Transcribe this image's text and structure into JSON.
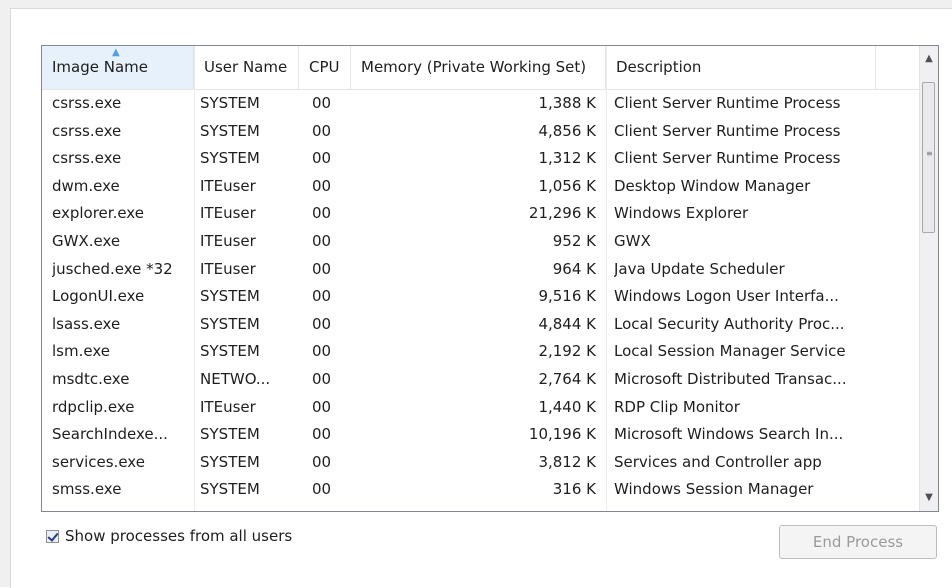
{
  "columns": {
    "image_name": "Image Name",
    "user_name": "User Name",
    "cpu": "CPU",
    "memory": "Memory (Private Working Set)",
    "description": "Description"
  },
  "processes": [
    {
      "name": "csrss.exe",
      "user": "SYSTEM",
      "cpu": "00",
      "mem": "1,388 K",
      "desc": "Client Server Runtime Process"
    },
    {
      "name": "csrss.exe",
      "user": "SYSTEM",
      "cpu": "00",
      "mem": "4,856 K",
      "desc": "Client Server Runtime Process"
    },
    {
      "name": "csrss.exe",
      "user": "SYSTEM",
      "cpu": "00",
      "mem": "1,312 K",
      "desc": "Client Server Runtime Process"
    },
    {
      "name": "dwm.exe",
      "user": "ITEuser",
      "cpu": "00",
      "mem": "1,056 K",
      "desc": "Desktop Window Manager"
    },
    {
      "name": "explorer.exe",
      "user": "ITEuser",
      "cpu": "00",
      "mem": "21,296 K",
      "desc": "Windows Explorer"
    },
    {
      "name": "GWX.exe",
      "user": "ITEuser",
      "cpu": "00",
      "mem": "952 K",
      "desc": "GWX"
    },
    {
      "name": "jusched.exe *32",
      "user": "ITEuser",
      "cpu": "00",
      "mem": "964 K",
      "desc": "Java Update Scheduler"
    },
    {
      "name": "LogonUI.exe",
      "user": "SYSTEM",
      "cpu": "00",
      "mem": "9,516 K",
      "desc": "Windows Logon User Interfa..."
    },
    {
      "name": "lsass.exe",
      "user": "SYSTEM",
      "cpu": "00",
      "mem": "4,844 K",
      "desc": "Local Security Authority Proc..."
    },
    {
      "name": "lsm.exe",
      "user": "SYSTEM",
      "cpu": "00",
      "mem": "2,192 K",
      "desc": "Local Session Manager Service"
    },
    {
      "name": "msdtc.exe",
      "user": "NETWO...",
      "cpu": "00",
      "mem": "2,764 K",
      "desc": "Microsoft Distributed Transac..."
    },
    {
      "name": "rdpclip.exe",
      "user": "ITEuser",
      "cpu": "00",
      "mem": "1,440 K",
      "desc": "RDP Clip Monitor"
    },
    {
      "name": "SearchIndexe...",
      "user": "SYSTEM",
      "cpu": "00",
      "mem": "10,196 K",
      "desc": "Microsoft Windows Search In..."
    },
    {
      "name": "services.exe",
      "user": "SYSTEM",
      "cpu": "00",
      "mem": "3,812 K",
      "desc": "Services and Controller app"
    },
    {
      "name": "smss.exe",
      "user": "SYSTEM",
      "cpu": "00",
      "mem": "316 K",
      "desc": "Windows Session Manager"
    }
  ],
  "sort_indicator": "sort-ascending-arrow",
  "show_all_label": "Show processes from all users",
  "show_all_checked": true,
  "end_process_label": "End Process",
  "colors": {
    "sorted_header_bg": "#e6f1fb",
    "disabled_text": "#9a9a9a"
  }
}
